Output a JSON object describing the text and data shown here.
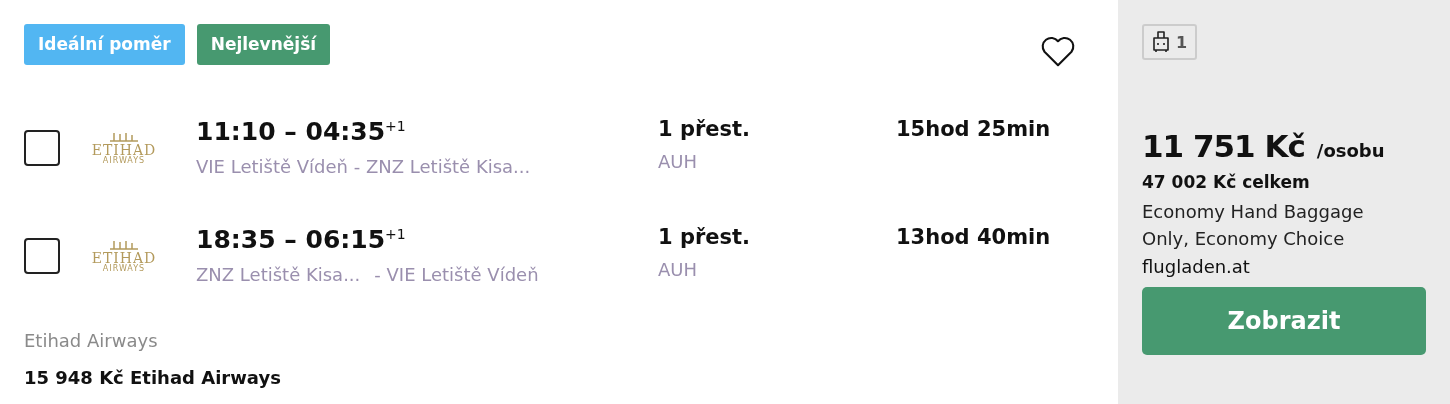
{
  "badges": [
    {
      "label": "Ideální poměr",
      "kind": "ideal"
    },
    {
      "label": "Nejlevnější",
      "kind": "cheapest"
    }
  ],
  "favorite": {
    "selected": false
  },
  "legs": [
    {
      "checked": false,
      "logo": {
        "name": "ETIHAD",
        "sub": "AIRWAYS"
      },
      "times": "11:10 – 04:35",
      "day_offset": "+1",
      "route": [
        {
          "text": "VIE Letiště Vídeň - ZNZ Letiště Kisa..."
        }
      ],
      "stops": "1 přest.",
      "via": "AUH",
      "duration": "15hod 25min"
    },
    {
      "checked": false,
      "logo": {
        "name": "ETIHAD",
        "sub": "AIRWAYS"
      },
      "times": "18:35 – 06:15",
      "day_offset": "+1",
      "route": [
        {
          "text": "ZNZ Letiště Kisa..."
        },
        {
          "text": "- VIE Letiště Vídeň"
        }
      ],
      "stops": "1 přest.",
      "via": "AUH",
      "duration": "13hod 40min"
    }
  ],
  "carrier": "Etihad Airways",
  "alt_price": "15 948 Kč Etihad Airways",
  "offer": {
    "bags": "1",
    "price": "11 751 Kč",
    "per": "/osobu",
    "total": "47 002 Kč celkem",
    "fare": "Economy Hand Baggage Only, Economy Choice",
    "seller": "flugladen.at",
    "button": "Zobrazit"
  }
}
